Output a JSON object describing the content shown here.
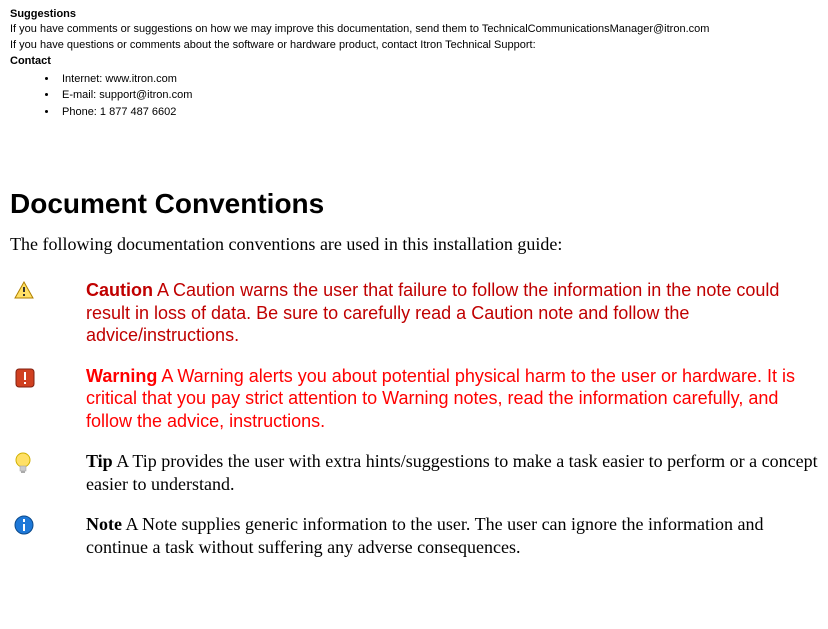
{
  "suggestions_heading": "Suggestions",
  "suggestions_para": "If you have comments or suggestions on how we may improve this documentation, send them to TechnicalCommunicationsManager@itron.com",
  "support_para": "If you have questions or comments about the software or hardware product, contact Itron Technical Support:",
  "contact_heading": "Contact",
  "contact_items": [
    "Internet: www.itron.com",
    "E-mail: support@itron.com",
    "Phone: 1 877 487 6602"
  ],
  "main_heading": "Document Conventions",
  "intro_para": "The following documentation conventions are used in this installation guide:",
  "conventions": {
    "caution": {
      "label": "Caution",
      "body": "  A Caution warns the user that failure to follow the information in the note could result in loss of data. Be sure to carefully read a Caution note and follow the advice/instructions."
    },
    "warning": {
      "label": "Warning",
      "body": "  A Warning alerts you about potential physical harm to the user or hardware. It is critical that you pay strict attention to Warning notes, read the information carefully, and follow the advice, instructions."
    },
    "tip": {
      "label": "Tip",
      "body": "  A Tip provides the user with extra hints/suggestions to make a task easier to perform or a concept easier to understand."
    },
    "note": {
      "label": "Note",
      "body": "  A Note supplies generic information to the user. The user can ignore the information and continue a task without suffering any adverse consequences."
    }
  }
}
